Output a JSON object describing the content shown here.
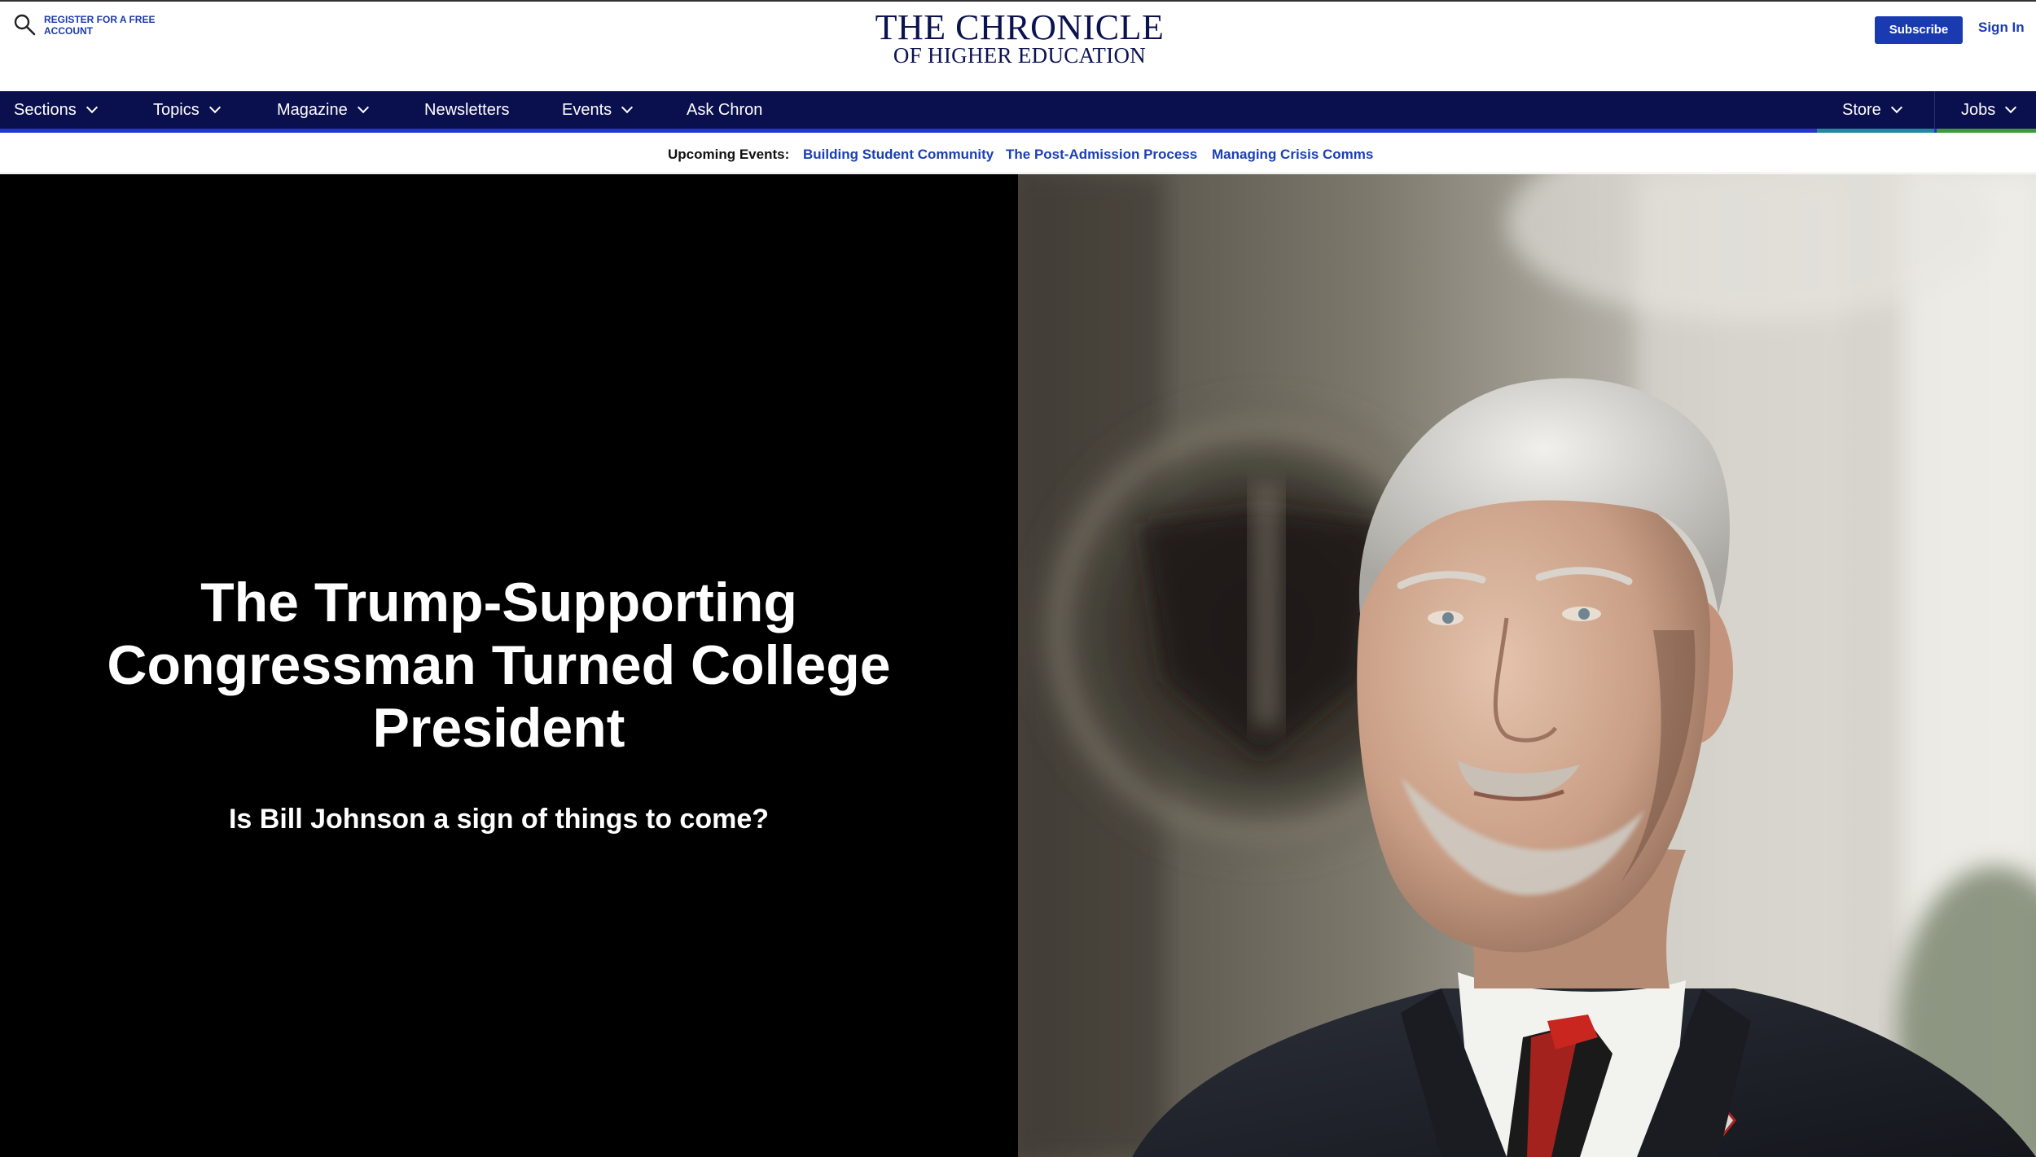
{
  "header": {
    "register_label": "REGISTER FOR A FREE ACCOUNT",
    "logo_line1": "THE CHRONICLE",
    "logo_line2": "OF HIGHER EDUCATION",
    "subscribe_label": "Subscribe",
    "signin_label": "Sign In",
    "search_icon": "search-icon"
  },
  "nav": {
    "items": [
      {
        "label": "Sections",
        "has_dropdown": true
      },
      {
        "label": "Topics",
        "has_dropdown": true
      },
      {
        "label": "Magazine",
        "has_dropdown": true
      },
      {
        "label": "Newsletters",
        "has_dropdown": false
      },
      {
        "label": "Events",
        "has_dropdown": true
      },
      {
        "label": "Ask Chron",
        "has_dropdown": false
      }
    ],
    "right_items": [
      {
        "label": "Store",
        "has_dropdown": true
      },
      {
        "label": "Jobs",
        "has_dropdown": true
      }
    ]
  },
  "events": {
    "label": "Upcoming Events:",
    "links": [
      "Building Student Community",
      "The Post-Admission Process",
      "Managing Crisis Comms"
    ]
  },
  "hero": {
    "title": "The Trump-Supporting Congressman Turned College President",
    "subtitle": "Is Bill Johnson a sign of things to come?"
  },
  "colors": {
    "brand_navy": "#0a0f4d",
    "link_blue": "#1b3fb5",
    "subscribe_blue": "#1a3bb0",
    "store_accent": "#1d8aa0",
    "jobs_accent": "#3a9a3c"
  }
}
